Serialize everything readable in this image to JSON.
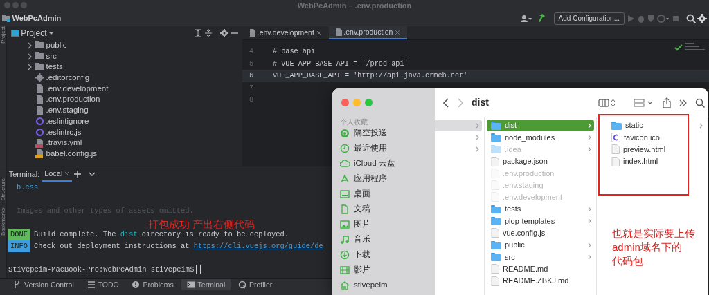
{
  "window": {
    "title": "WebPcAdmin – .env.production"
  },
  "toolbar": {
    "project": "WebPcAdmin",
    "run_config": "Add Configuration..."
  },
  "left_strip": {
    "top": [
      "Project"
    ],
    "bottom": [
      "Structure",
      "Bookmarks"
    ]
  },
  "project_panel": {
    "title": "Project",
    "tree": [
      {
        "name": "public",
        "kind": "folder",
        "expanded": false
      },
      {
        "name": "src",
        "kind": "folder",
        "expanded": false
      },
      {
        "name": "tests",
        "kind": "folder",
        "expanded": false
      },
      {
        "name": ".editorconfig",
        "kind": "config"
      },
      {
        "name": ".env.development",
        "kind": "file"
      },
      {
        "name": ".env.production",
        "kind": "file"
      },
      {
        "name": ".env.staging",
        "kind": "file"
      },
      {
        "name": ".eslintignore",
        "kind": "eslint"
      },
      {
        "name": ".eslintrc.js",
        "kind": "eslint"
      },
      {
        "name": ".travis.yml",
        "kind": "yaml"
      },
      {
        "name": "babel.config.js",
        "kind": "js"
      }
    ]
  },
  "editor": {
    "tabs": [
      {
        "label": ".env.development",
        "selected": false
      },
      {
        "label": ".env.production",
        "selected": true
      }
    ],
    "lines": [
      {
        "number": "4",
        "text": "# base api",
        "current": false
      },
      {
        "number": "5",
        "text": "# VUE_APP_BASE_API = '/prod-api'",
        "current": false
      },
      {
        "number": "6",
        "text": "VUE_APP_BASE_API = 'http://api.java.crmeb.net'",
        "current": true
      },
      {
        "number": "7",
        "current": false
      },
      {
        "number": "8",
        "current": false
      }
    ]
  },
  "terminal": {
    "label": "Terminal:",
    "tabs": [
      {
        "label": "Local",
        "selected": true
      }
    ],
    "lines": [
      {
        "kind": "file",
        "text": "b.css"
      },
      {
        "kind": "blank"
      },
      {
        "kind": "note",
        "text": "Images and other types of assets omitted."
      },
      {
        "kind": "blank"
      },
      {
        "kind": "status",
        "badge": "DONE",
        "color": "#5fb85a",
        "before": "Build complete. The ",
        "highlight": "dist",
        "after": " directory is ready to be deployed."
      },
      {
        "kind": "status",
        "badge": "INFO",
        "color": "#3d9de0",
        "before": "Check out deployment instructions at ",
        "link": "https://cli.vuejs.org/guide/de"
      },
      {
        "kind": "blank"
      },
      {
        "kind": "prompt",
        "text": "Stivepeim-MacBook-Pro:WebPcAdmin stivepeim$"
      }
    ],
    "annotation": "打包成功 产出右侧代码"
  },
  "tool_windows": [
    {
      "label": "Version Control",
      "kind": "vcs",
      "selected": false
    },
    {
      "label": "TODO",
      "kind": "todo",
      "selected": false
    },
    {
      "label": "Problems",
      "kind": "problems",
      "selected": false
    },
    {
      "label": "Terminal",
      "kind": "terminal",
      "selected": true
    },
    {
      "label": "Profiler",
      "kind": "profiler",
      "selected": false
    }
  ],
  "finder": {
    "title": "dist",
    "sidebar": {
      "section": "个人收藏",
      "items": [
        {
          "label": "隔空投送",
          "kind": "airdrop"
        },
        {
          "label": "最近使用",
          "kind": "recent"
        },
        {
          "label": "iCloud 云盘",
          "kind": "cloud"
        },
        {
          "label": "应用程序",
          "kind": "apps"
        },
        {
          "label": "桌面",
          "kind": "desktop"
        },
        {
          "label": "文稿",
          "kind": "document"
        },
        {
          "label": "图片",
          "kind": "pictures"
        },
        {
          "label": "音乐",
          "kind": "music"
        },
        {
          "label": "下载",
          "kind": "download"
        },
        {
          "label": "影片",
          "kind": "movies"
        },
        {
          "label": "stivepeim",
          "kind": "home"
        }
      ]
    },
    "column_1": [
      {
        "selected": true
      },
      {
        "selected": false
      },
      {
        "selected": false
      }
    ],
    "column_2": [
      {
        "name": "dist",
        "kind": "folder",
        "selected": true,
        "hidden": false
      },
      {
        "name": "node_modules",
        "kind": "folder",
        "selected": false,
        "hidden": false
      },
      {
        "name": ".idea",
        "kind": "folder",
        "selected": false,
        "hidden": true
      },
      {
        "name": "package.json",
        "kind": "file",
        "selected": false,
        "hidden": false
      },
      {
        "name": ".env.production",
        "kind": "file",
        "selected": false,
        "hidden": true
      },
      {
        "name": ".env.staging",
        "kind": "file",
        "selected": false,
        "hidden": true
      },
      {
        "name": ".env.development",
        "kind": "file",
        "selected": false,
        "hidden": true
      },
      {
        "name": "tests",
        "kind": "folder",
        "selected": false,
        "hidden": false
      },
      {
        "name": "plop-templates",
        "kind": "folder",
        "selected": false,
        "hidden": false
      },
      {
        "name": "vue.config.js",
        "kind": "file",
        "selected": false,
        "hidden": false
      },
      {
        "name": "public",
        "kind": "folder",
        "selected": false,
        "hidden": false
      },
      {
        "name": "src",
        "kind": "folder",
        "selected": false,
        "hidden": false
      },
      {
        "name": "README.md",
        "kind": "file",
        "selected": false,
        "hidden": false
      },
      {
        "name": "README.ZBKJ.md",
        "kind": "file",
        "selected": false,
        "hidden": false
      }
    ],
    "column_3": [
      {
        "name": "static",
        "kind": "folder",
        "selected": false,
        "hidden": false
      },
      {
        "name": "favicon.ico",
        "kind": "favicon",
        "selected": false,
        "hidden": false
      },
      {
        "name": "preview.html",
        "kind": "file",
        "selected": false,
        "hidden": false
      },
      {
        "name": "index.html",
        "kind": "file",
        "selected": false,
        "hidden": false
      }
    ],
    "annotation": [
      "也就是实际要上传",
      "admin域名下的",
      "代码包"
    ]
  }
}
